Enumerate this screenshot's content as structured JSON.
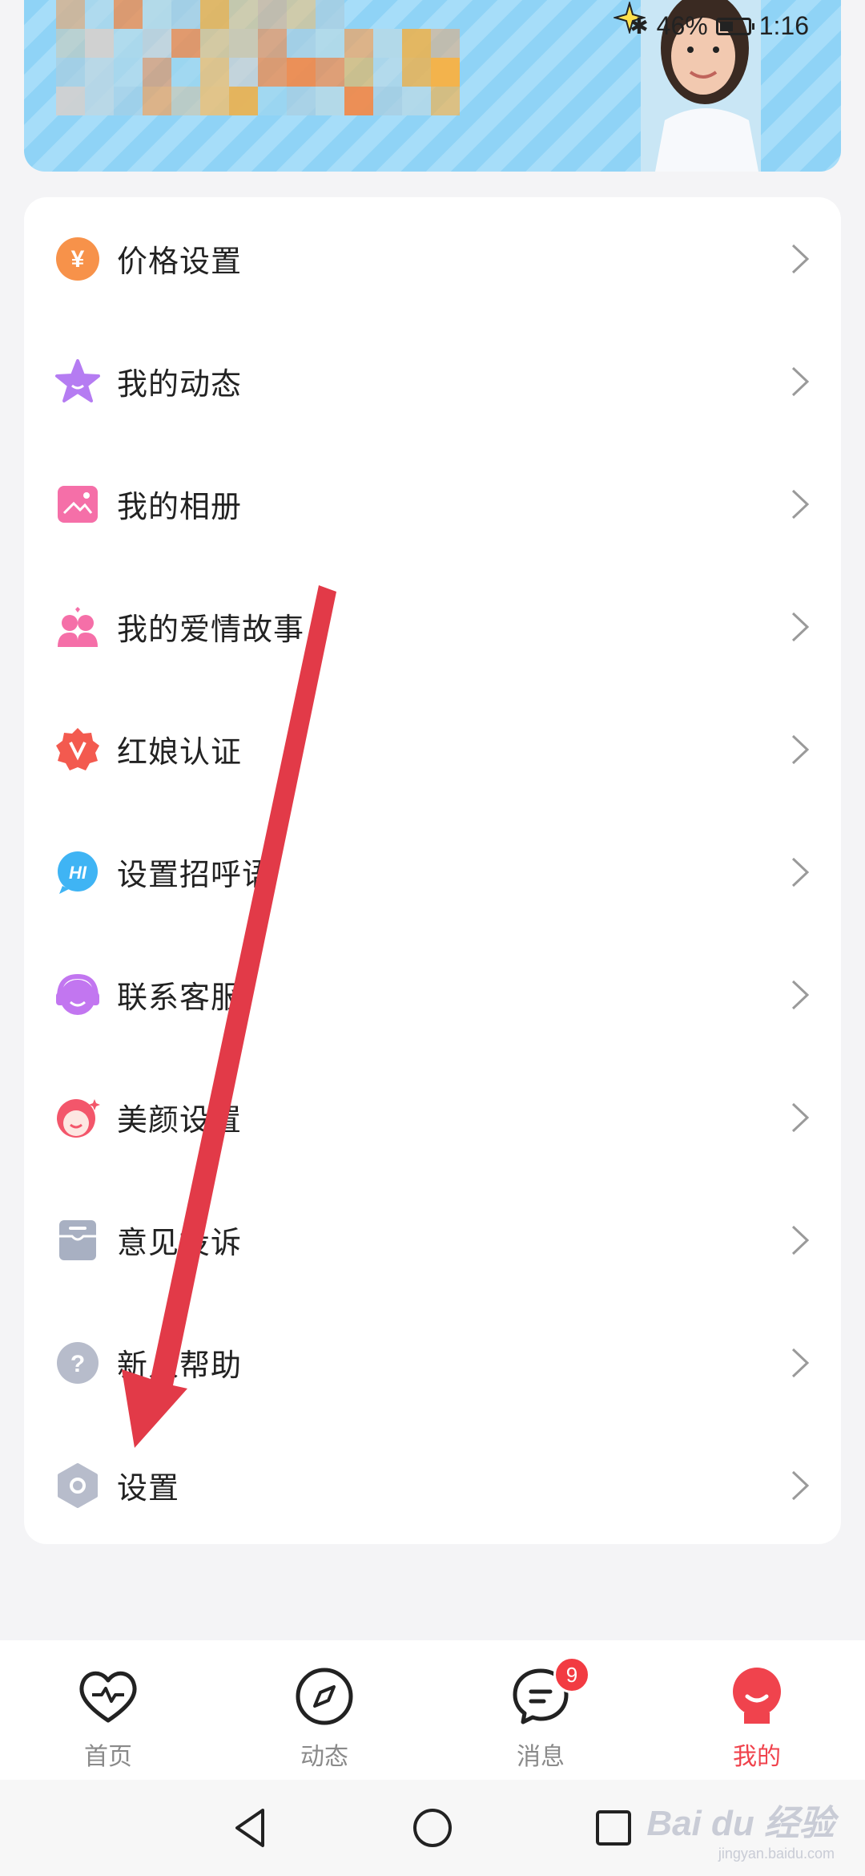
{
  "status_bar": {
    "bluetooth": "✱",
    "battery_percent": "46%",
    "time": "1:16"
  },
  "menu": {
    "items": [
      {
        "label": "价格设置",
        "icon": "yuan-coin-icon",
        "color": "#f7924a"
      },
      {
        "label": "我的动态",
        "icon": "star-icon",
        "color": "#b57cf2"
      },
      {
        "label": "我的相册",
        "icon": "photo-album-icon",
        "color": "#f56fa8"
      },
      {
        "label": "我的爱情故事",
        "icon": "couple-icon",
        "color": "#f56fa8"
      },
      {
        "label": "红娘认证",
        "icon": "verified-badge-icon",
        "color": "#f35a4f"
      },
      {
        "label": "设置招呼语",
        "icon": "hi-bubble-icon",
        "color": "#3fb4f4"
      },
      {
        "label": "联系客服",
        "icon": "headset-icon",
        "color": "#c276f0"
      },
      {
        "label": "美颜设置",
        "icon": "beauty-face-icon",
        "color": "#f3566b"
      },
      {
        "label": "意见投诉",
        "icon": "mailbox-icon",
        "color": "#a8b0c2"
      },
      {
        "label": "新人帮助",
        "icon": "question-icon",
        "color": "#b7bccb"
      },
      {
        "label": "设置",
        "icon": "settings-hex-icon",
        "color": "#b7bccb"
      }
    ]
  },
  "tab_bar": {
    "tabs": [
      {
        "label": "首页",
        "icon": "heart-pulse-icon",
        "active": false
      },
      {
        "label": "动态",
        "icon": "compass-icon",
        "active": false
      },
      {
        "label": "消息",
        "icon": "chat-icon",
        "active": false,
        "badge": "9"
      },
      {
        "label": "我的",
        "icon": "profile-icon",
        "active": true
      }
    ]
  },
  "system_nav": {
    "buttons": [
      "back-icon",
      "home-icon",
      "recents-icon"
    ]
  },
  "watermark": {
    "logo": "Bai du 经验",
    "sub": "jingyan.baidu.com"
  },
  "colors": {
    "accent": "#f0434d",
    "annotation_arrow": "#e23a48",
    "banner": "#8fd3f6"
  }
}
